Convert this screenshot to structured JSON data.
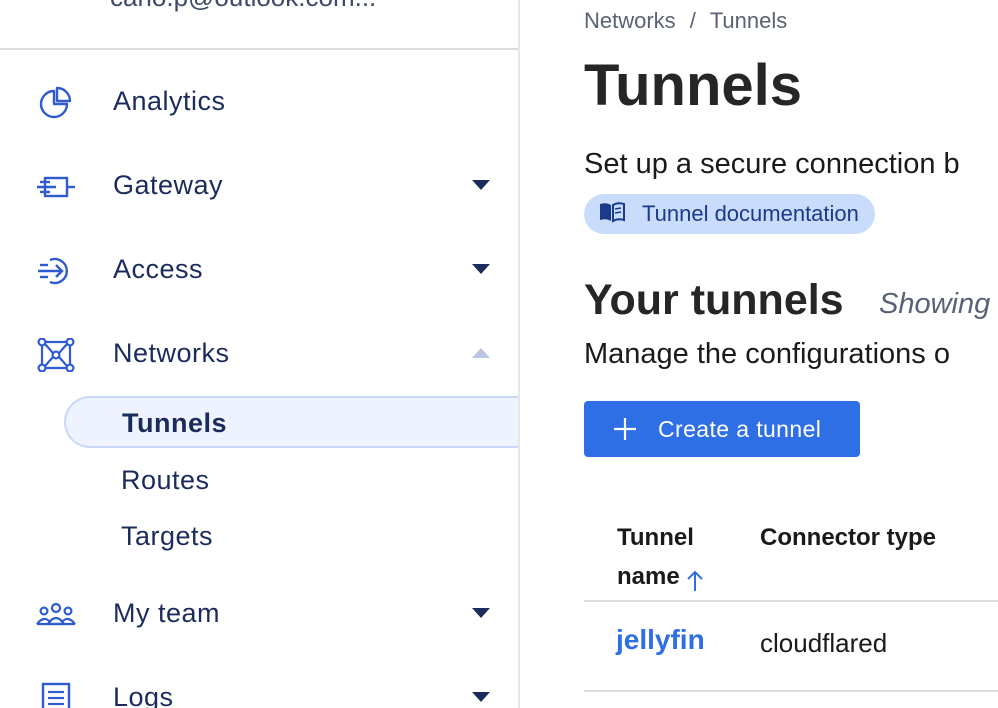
{
  "sidebar": {
    "account_text": "carlo.p@outlook.com...",
    "items": [
      {
        "label": "Analytics",
        "icon": "pie-chart-icon",
        "has_caret": false
      },
      {
        "label": "Gateway",
        "icon": "gateway-icon",
        "caret": "down"
      },
      {
        "label": "Access",
        "icon": "access-icon",
        "caret": "down"
      },
      {
        "label": "Networks",
        "icon": "network-icon",
        "caret": "up"
      },
      {
        "label": "My team",
        "icon": "team-icon",
        "caret": "down"
      },
      {
        "label": "Logs",
        "icon": "logs-icon",
        "caret": "down"
      }
    ],
    "sub_items": [
      {
        "label": "Tunnels",
        "active": true
      },
      {
        "label": "Routes",
        "active": false
      },
      {
        "label": "Targets",
        "active": false
      }
    ]
  },
  "main": {
    "breadcrumb": {
      "parent": "Networks",
      "separator": "/",
      "current": "Tunnels"
    },
    "title": "Tunnels",
    "description": "Set up a secure connection b",
    "doc_link": {
      "label": "Tunnel documentation",
      "icon": "book-icon"
    },
    "section": {
      "title": "Your tunnels",
      "subtitle": "Showing",
      "description": "Manage the configurations o"
    },
    "create_button": {
      "label": "Create a tunnel",
      "icon": "plus-icon"
    },
    "table": {
      "headers": {
        "name": "Tunnel name",
        "connector_type": "Connector type"
      },
      "sort": "ascending",
      "rows": [
        {
          "name": "jellyfin",
          "connector_type": "cloudflared"
        }
      ]
    }
  },
  "colors": {
    "accent": "#2f6fe6",
    "nav_text": "#1b2c5c",
    "pill_bg": "#c9dcfb",
    "active_bg": "#eef3ff"
  }
}
